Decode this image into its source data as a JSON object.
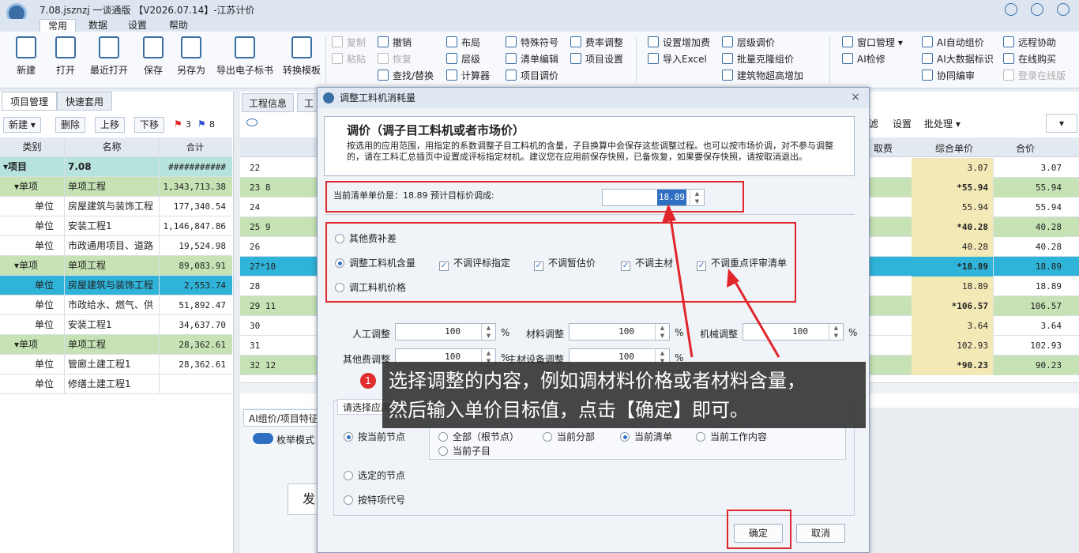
{
  "window": {
    "title": "7.08.jsznzj 一谈通版 【V2026.07.14】-江苏计价"
  },
  "menu": [
    "常用",
    "数据",
    "设置",
    "帮助"
  ],
  "ribbon": {
    "big": [
      "新建",
      "打开",
      "最近打开",
      "保存",
      "另存为",
      "导出电子标书",
      "转换模板"
    ],
    "col1": [
      "复制",
      "粘贴"
    ],
    "col2": [
      "撤销",
      "恢复",
      "查找/替换"
    ],
    "col3": [
      "布局",
      "层级",
      "计算器"
    ],
    "col4": [
      "特殊符号",
      "清单编辑",
      "项目调价"
    ],
    "col5": [
      "费率调整",
      "项目设置"
    ],
    "col6": [
      "设置增加费",
      "导入Excel"
    ],
    "col7": [
      "层级调价",
      "批量克隆组价",
      "建筑物超高增加"
    ],
    "col8": [
      "窗口管理",
      "AI检修"
    ],
    "col9": [
      "AI自动组价",
      "AI大数据标识",
      "协同编审"
    ],
    "col10": [
      "远程协助",
      "在线购买",
      "登录在线版"
    ]
  },
  "left": {
    "tabs": [
      "项目管理",
      "快速套用"
    ],
    "buttons": [
      "新建",
      "删除",
      "上移",
      "下移"
    ],
    "flags": [
      "3",
      "8"
    ],
    "headers": [
      "类别",
      "名称",
      "合计"
    ],
    "rows": [
      {
        "cat": "▾项目",
        "name": "7.08",
        "total": "###########",
        "style": "t"
      },
      {
        "cat": "▾单项",
        "name": "单项工程",
        "total": "1,343,713.38",
        "style": "g"
      },
      {
        "cat": "单位",
        "name": "房屋建筑与装饰工程",
        "total": "177,340.54",
        "style": ""
      },
      {
        "cat": "单位",
        "name": "安装工程1",
        "total": "1,146,847.86",
        "style": ""
      },
      {
        "cat": "单位",
        "name": "市政通用项目、道路",
        "total": "19,524.98",
        "style": ""
      },
      {
        "cat": "▾单项",
        "name": "单项工程",
        "total": "89,083.91",
        "style": "g"
      },
      {
        "cat": "单位",
        "name": "房屋建筑与装饰工程",
        "total": "2,553.74",
        "style": "sel"
      },
      {
        "cat": "单位",
        "name": "市政给水、燃气、供",
        "total": "51,892.47",
        "style": ""
      },
      {
        "cat": "单位",
        "name": "安装工程1",
        "total": "34,637.70",
        "style": ""
      },
      {
        "cat": "▾单项",
        "name": "单项工程",
        "total": "28,362.61",
        "style": "g"
      },
      {
        "cat": "单位",
        "name": "管廊土建工程1",
        "total": "28,362.61",
        "style": ""
      },
      {
        "cat": "单位",
        "name": "修缮土建工程1",
        "total": "",
        "style": ""
      }
    ]
  },
  "right": {
    "tabs": [
      "工程信息",
      "工"
    ],
    "toolbar": [
      "滤",
      "设置",
      "批处理"
    ],
    "headers": [
      "取费",
      "综合单价",
      "合价"
    ],
    "rows": [
      {
        "no": "22",
        "u": "3.07",
        "t": "3.07",
        "style": ""
      },
      {
        "no": "23 8",
        "u": "*55.94",
        "t": "55.94",
        "style": "g"
      },
      {
        "no": "24",
        "u": "55.94",
        "t": "55.94",
        "style": ""
      },
      {
        "no": "25 9",
        "u": "*40.28",
        "t": "40.28",
        "style": "g"
      },
      {
        "no": "26",
        "u": "40.28",
        "t": "40.28",
        "style": ""
      },
      {
        "no": "27*10",
        "u": "*18.89",
        "t": "18.89",
        "style": "sel"
      },
      {
        "no": "28",
        "u": "18.89",
        "t": "18.89",
        "style": ""
      },
      {
        "no": "29 11",
        "u": "*106.57",
        "t": "106.57",
        "style": "g"
      },
      {
        "no": "30",
        "u": "3.64",
        "t": "3.64",
        "style": ""
      },
      {
        "no": "31",
        "u": "102.93",
        "t": "102.93",
        "style": ""
      },
      {
        "no": "32 12",
        "u": "*90.23",
        "t": "90.23",
        "style": "g"
      }
    ],
    "lower_tab": "AI组价/项目特征",
    "enum_mode": "枚举模式",
    "send_label": "发"
  },
  "dialog": {
    "title": "调整工料机消耗量",
    "info_title": "调价（调子目工料机或者市场价）",
    "info_text": "按选用的应用范围，用指定的系数调整子目工料机的含量，子目换算中会保存这些调整过程。也可以按市场价调，对不参与调整的，请在工料汇总插页中设置成评标指定材机。建议您在应用前保存快照，已备恢复，如果要保存快照，请按取消退出。",
    "target_label": "当前清单单价是：18.89 预计目标价调成:",
    "target_value": "18.89",
    "options": [
      "其他费补差",
      "调整工料机含量",
      "调工料机价格"
    ],
    "checks": [
      "不调评标指定",
      "不调暂估价",
      "不调主材",
      "不调重点评审清单"
    ],
    "adjust": [
      {
        "label": "人工调整",
        "value": "100"
      },
      {
        "label": "材料调整",
        "value": "100"
      },
      {
        "label": "机械调整",
        "value": "100"
      },
      {
        "label": "其他费调整",
        "value": "100"
      },
      {
        "label": "主材设备调整",
        "value": "100"
      }
    ],
    "percent": "%",
    "scope_tab": "请选择应用",
    "scope": [
      "按当前节点",
      "选定的节点",
      "按特项代号"
    ],
    "scope_sub": [
      "全部（根节点）",
      "当前分部",
      "当前清单",
      "当前工作内容",
      "当前子目"
    ],
    "ok": "确定",
    "cancel": "取消"
  },
  "tooltip": {
    "num": "1",
    "line1": "选择调整的内容，例如调材料价格或者材料含量，",
    "line2": "然后输入单价目标值，点击【确定】即可。"
  },
  "colors": {
    "accent": "#2fb3d8",
    "highlight_red": "#e0262b",
    "green_row": "#c7e3b5",
    "yellow_col": "#f3e9b6"
  }
}
